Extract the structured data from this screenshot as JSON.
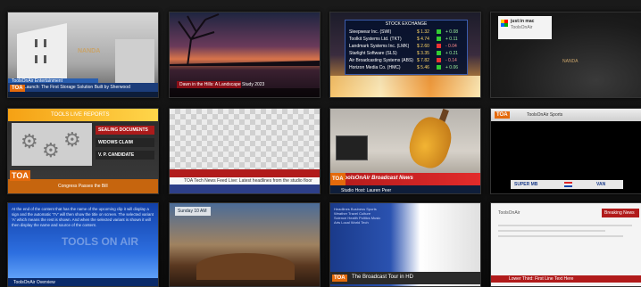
{
  "tiles": {
    "t1": {
      "bug": "NANDA",
      "lower": "Launch: The First Storage Solution Built by Sherwood",
      "top": "ToolsOnAir Entertainment",
      "logo": "TOA"
    },
    "t2": {
      "lower": "Dawn in the Hills: A Landscape Study 2023"
    },
    "t3": {
      "title": "STOCK EXCHANGE",
      "rows": [
        {
          "name": "Sleepwear Inc. (SWI)",
          "value": "$ 1.32",
          "change": "+ 0.08"
        },
        {
          "name": "Toolkit Systems Ltd. (TKT)",
          "value": "$ 4.74",
          "change": "+ 0.11"
        },
        {
          "name": "Landmark Systems Inc. (LMK)",
          "value": "$ 2.60",
          "change": "- 0.04"
        },
        {
          "name": "Starlight Software (SLS)",
          "value": "$ 3.35",
          "change": "+ 0.21"
        },
        {
          "name": "Air Broadcasting Systems (ABS)",
          "value": "$ 7.82",
          "change": "- 0.14"
        },
        {
          "name": "Horizon Media Co. (HMC)",
          "value": "$ 5.46",
          "change": "+ 0.06"
        }
      ]
    },
    "t4": {
      "card_title": "just:in mac",
      "card_sub": "ToolsOnAir",
      "bug": "NANDA"
    },
    "t5": {
      "header": "TOOLS LIVE REPORTS",
      "menu": [
        "SEALING DOCUMENTS",
        "WIDOWS CLAIM",
        "V. P. CANDIDATE"
      ],
      "logo": "TOA",
      "footer": "Congress Passes the Bill"
    },
    "t6": {
      "ticker": "TOA Tech News Feed Live: Latest headlines from the studio floor"
    },
    "t7": {
      "headline": "ToolsOnAir Broadcast News",
      "sub": "Studio Host: Lauren Peer",
      "logo": "TOA"
    },
    "t8": {
      "top": "ToolsOnAir Sports",
      "left": "SUPER MB",
      "right": "VAN"
    },
    "t9": {
      "body": "At the end of the content that has the name of the upcoming clip it will display a sign and the automatic 'TV' will then show the title on screen. The selected variant 'A' which means the rest is shown. And when the selected variant is shown it will then display the name and source of the content.",
      "watermark": "TOOLS ON AIR",
      "footer": "ToolsOnAir Overview"
    },
    "t10": {
      "tag": "Sunday 10 AM"
    },
    "t11": {
      "list": "Headlines  Business  Sports  Weather  Travel  Culture  Science  Health  Politics  Music  Arts  Local  World  Tech",
      "logo": "TOA",
      "bar": "The Broadcast Tour in HD"
    },
    "t12": {
      "tag": "Breaking News",
      "top": "ToolsOnAir",
      "footer": "Lower Third: First Line Text Here"
    }
  }
}
